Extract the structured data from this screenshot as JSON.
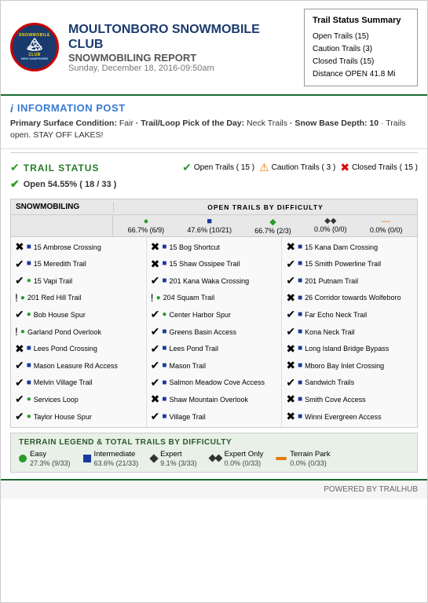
{
  "header": {
    "club_name_line1": "MOULTONBORO SNOWMOBILE",
    "club_name_line2": "CLUB",
    "report_title": "SNOWMOBILING REPORT",
    "report_date": "Sunday, December 18, 2016-09:50am"
  },
  "trail_summary": {
    "title": "Trail Status Summary",
    "open": "Open Trails (15)",
    "caution": "Caution Trails (3)",
    "closed": "Closed Trails (15)",
    "distance": "Distance OPEN 41.8 Mi"
  },
  "info": {
    "title": "INFORMATION POST",
    "text_parts": {
      "surface_label": "Primary Surface Condition:",
      "surface_value": " Fair",
      "pick_label": " · Trail/Loop Pick of the Day:",
      "pick_value": " Neck Trails",
      "depth_label": " · Snow Base Depth:",
      "depth_value": " 10",
      "extra": " · Trails open. STAY OFF LAKES!"
    }
  },
  "trail_status": {
    "title": "TRAIL STATUS",
    "open_pct": "Open 54.55% ( 18 / 33 )",
    "open_badge": "Open Trails ( 15 )",
    "caution_badge": "Caution Trails ( 3 )",
    "closed_badge": "Closed Trails ( 15 )"
  },
  "snowmobiling": {
    "section_label": "SNOWMOBILING",
    "open_trails_label": "OPEN TRAILS BY DIFFICULTY",
    "difficulties": [
      {
        "icon": "●",
        "color": "#2a9a2a",
        "value": "66.7% (6/9)"
      },
      {
        "icon": "■",
        "color": "#1a3a9e",
        "value": "47.6% (10/21)"
      },
      {
        "icon": "◆",
        "color": "#2a9a2a",
        "value": "66.7% (2/3)"
      },
      {
        "icon": "◆◆",
        "color": "#333",
        "value": "0.0% (0/0)"
      },
      {
        "icon": "—",
        "color": "#e87800",
        "value": "0.0% (0/0)"
      }
    ],
    "trails_col1": [
      {
        "status": "closed",
        "diff": "inter",
        "name": "15 Ambrose Crossing"
      },
      {
        "status": "open",
        "diff": "inter",
        "name": "15 Meredith Trail"
      },
      {
        "status": "open",
        "diff": "easy",
        "name": "15 Vapi Trail"
      },
      {
        "status": "caution",
        "diff": "easy",
        "name": "201 Red Hill Trail"
      },
      {
        "status": "open",
        "diff": "easy",
        "name": "Bob House Spur"
      },
      {
        "status": "caution",
        "diff": "easy",
        "name": "Garland Pond Overlook"
      },
      {
        "status": "closed",
        "diff": "inter",
        "name": "Lees Pond Crossing"
      },
      {
        "status": "open",
        "diff": "inter",
        "name": "Mason Leasure Rd Access"
      },
      {
        "status": "open",
        "diff": "inter",
        "name": "Melvin Village Trail"
      },
      {
        "status": "open",
        "diff": "easy",
        "name": "Services Loop"
      },
      {
        "status": "open",
        "diff": "easy",
        "name": "Taylor House Spur"
      }
    ],
    "trails_col2": [
      {
        "status": "closed",
        "diff": "inter",
        "name": "15 Bog Shortcut"
      },
      {
        "status": "closed",
        "diff": "inter",
        "name": "15 Shaw Ossipee Trail"
      },
      {
        "status": "open",
        "diff": "inter",
        "name": "201 Kana Waka Crossing"
      },
      {
        "status": "caution",
        "diff": "easy",
        "name": "204 Squam Trail"
      },
      {
        "status": "open",
        "diff": "easy",
        "name": "Center Harbor Spur"
      },
      {
        "status": "open",
        "diff": "inter",
        "name": "Greens Basin Access"
      },
      {
        "status": "open",
        "diff": "inter",
        "name": "Lees Pond Trail"
      },
      {
        "status": "open",
        "diff": "inter",
        "name": "Mason Trail"
      },
      {
        "status": "open",
        "diff": "inter",
        "name": "Salmon Meadow Cove Access"
      },
      {
        "status": "closed",
        "diff": "inter",
        "name": "Shaw Mountain Overlook"
      },
      {
        "status": "open",
        "diff": "inter",
        "name": "Village Trail"
      }
    ],
    "trails_col3": [
      {
        "status": "closed",
        "diff": "inter",
        "name": "15 Kana Dam Crossing"
      },
      {
        "status": "open",
        "diff": "inter",
        "name": "15 Smith Powerline Trail"
      },
      {
        "status": "open",
        "diff": "inter",
        "name": "201 Putnam Trail"
      },
      {
        "status": "closed",
        "diff": "inter",
        "name": "26 Corridor towards Wolfeboro"
      },
      {
        "status": "open",
        "diff": "inter",
        "name": "Far Echo Neck Trail"
      },
      {
        "status": "open",
        "diff": "inter",
        "name": "Kona Neck Trail"
      },
      {
        "status": "closed",
        "diff": "inter",
        "name": "Long Island Bridge Bypass"
      },
      {
        "status": "closed",
        "diff": "inter",
        "name": "Mboro Bay Inlet Crossing"
      },
      {
        "status": "open",
        "diff": "inter",
        "name": "Sandwich Trails"
      },
      {
        "status": "closed",
        "diff": "inter",
        "name": "Smith Cove Access"
      },
      {
        "status": "closed",
        "diff": "inter",
        "name": "Winni Evergreen Access"
      }
    ]
  },
  "legend": {
    "title": "TERRAIN LEGEND & TOTAL TRAILS by DIFFICULTY",
    "items": [
      {
        "type": "easy",
        "label": "Easy",
        "sub": "27.3% (9/33)"
      },
      {
        "type": "inter",
        "label": "Intermediate",
        "sub": "63.6% (21/33)"
      },
      {
        "type": "expert",
        "label": "Expert",
        "sub": "9.1% (3/33)"
      },
      {
        "type": "expert_only",
        "label": "Expert Only",
        "sub": "0.0% (0/33)"
      },
      {
        "type": "terrain",
        "label": "Terrain Park",
        "sub": "0.0% (0/33)"
      }
    ]
  },
  "footer": {
    "text": "POWERED BY TRAILHUB"
  }
}
